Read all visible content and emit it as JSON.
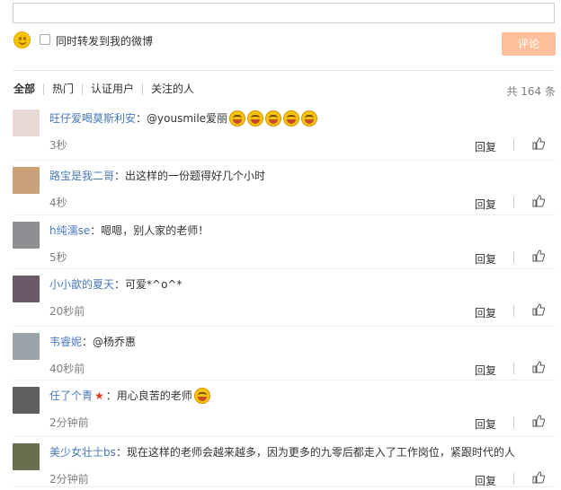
{
  "compose": {
    "text": "",
    "repost_label": "同时转发到我的微博",
    "comment_button": "评论"
  },
  "tabs": [
    "全部",
    "热门",
    "认证用户",
    "关注的人"
  ],
  "count_text": "共 164 条",
  "actions": {
    "reply": "回复"
  },
  "comments": [
    {
      "user": "旺仔爱喝莫斯利安",
      "text": "：@yousmile爱丽",
      "time": "3秒",
      "avatar_color": "#e8d9d4",
      "emoji_count": 5
    },
    {
      "user": "路宝是我二哥",
      "text": "：出这样的一份题得好几个小时",
      "time": "4秒",
      "avatar_color": "#c9a27a"
    },
    {
      "user": "h纯濡se",
      "text": "：嗯嗯，别人家的老师！",
      "time": "5秒",
      "avatar_color": "#8d8f92"
    },
    {
      "user": "小小歆的夏天",
      "text": "：可爱*^o^*",
      "time": "20秒前",
      "avatar_color": "#6a5a67"
    },
    {
      "user": "韦睿妮",
      "text": "：@杨乔惠",
      "time": "40秒前",
      "avatar_color": "#9aa3a8"
    },
    {
      "user": "任了个青",
      "text": "：用心良苦的老师",
      "time": "2分钟前",
      "avatar_color": "#5e5e5e",
      "star": true,
      "emoji_count": 1
    },
    {
      "user": "美少女壮士bs",
      "text": "：现在这样的老师会越来越多，因为更多的九零后都走入了工作岗位，紧跟时代的人",
      "time": "2分钟前",
      "avatar_color": "#6b6e4e"
    }
  ]
}
